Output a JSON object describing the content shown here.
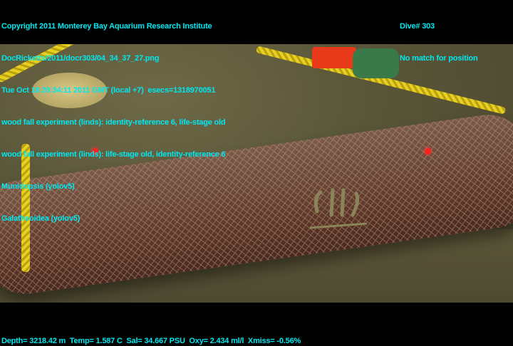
{
  "overlay_top_left": [
    "Copyright 2011 Monterey Bay Aquarium Research Institute",
    "DocRicketts/2011/docr303/04_34_37_27.png",
    "Tue Oct 18 20:34:11 2011 GMT (local +7)  esecs=1318970051",
    "wood fall experiment (linds): identity-reference 6, life-stage old",
    "wood fall experiment (linds): life-stage old, identity-reference 6",
    "Munidopsis (yolov5)",
    "Galatheoidea (yolov5)"
  ],
  "overlay_top_right": [
    "Dive# 303",
    "No match for position"
  ],
  "overlay_bottom": "Depth= 3218.42 m  Temp= 1.587 C  Sal= 34.667 PSU  Oxy= 2.434 ml/l  Xmiss= -0.56%",
  "colors": {
    "overlay_text": "#00e8f0",
    "laser": "#ff2020",
    "rope": "#e8d020"
  }
}
